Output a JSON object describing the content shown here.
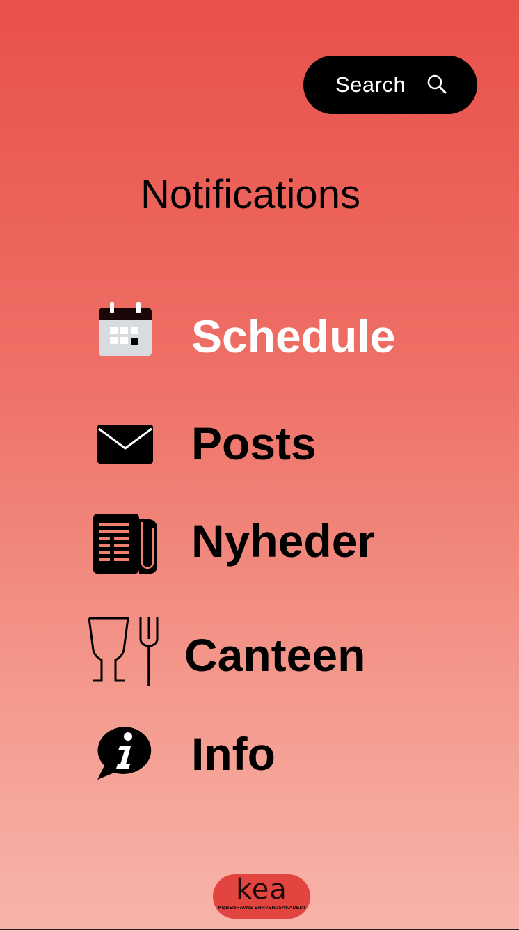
{
  "search": {
    "label": "Search",
    "icon": "search-icon"
  },
  "header": {
    "title": "Notifications"
  },
  "menu": {
    "items": [
      {
        "label": "Schedule",
        "icon": "calendar-icon",
        "color": "#ffffff"
      },
      {
        "label": "Posts",
        "icon": "envelope-icon",
        "color": "#000000"
      },
      {
        "label": "Nyheder",
        "icon": "newspaper-icon",
        "color": "#000000"
      },
      {
        "label": "Canteen",
        "icon": "glass-fork-icon",
        "color": "#000000"
      },
      {
        "label": "Info",
        "icon": "info-bubble-icon",
        "color": "#000000"
      }
    ]
  },
  "logo": {
    "word": "kea",
    "subtitle": "KØBENHAVNS ERHVERVSAKADEMI"
  },
  "colors": {
    "background_top": "#e9504b",
    "background_bottom": "#f8b4aa",
    "search_pill": "#000000",
    "logo_bg": "#e2453f"
  }
}
